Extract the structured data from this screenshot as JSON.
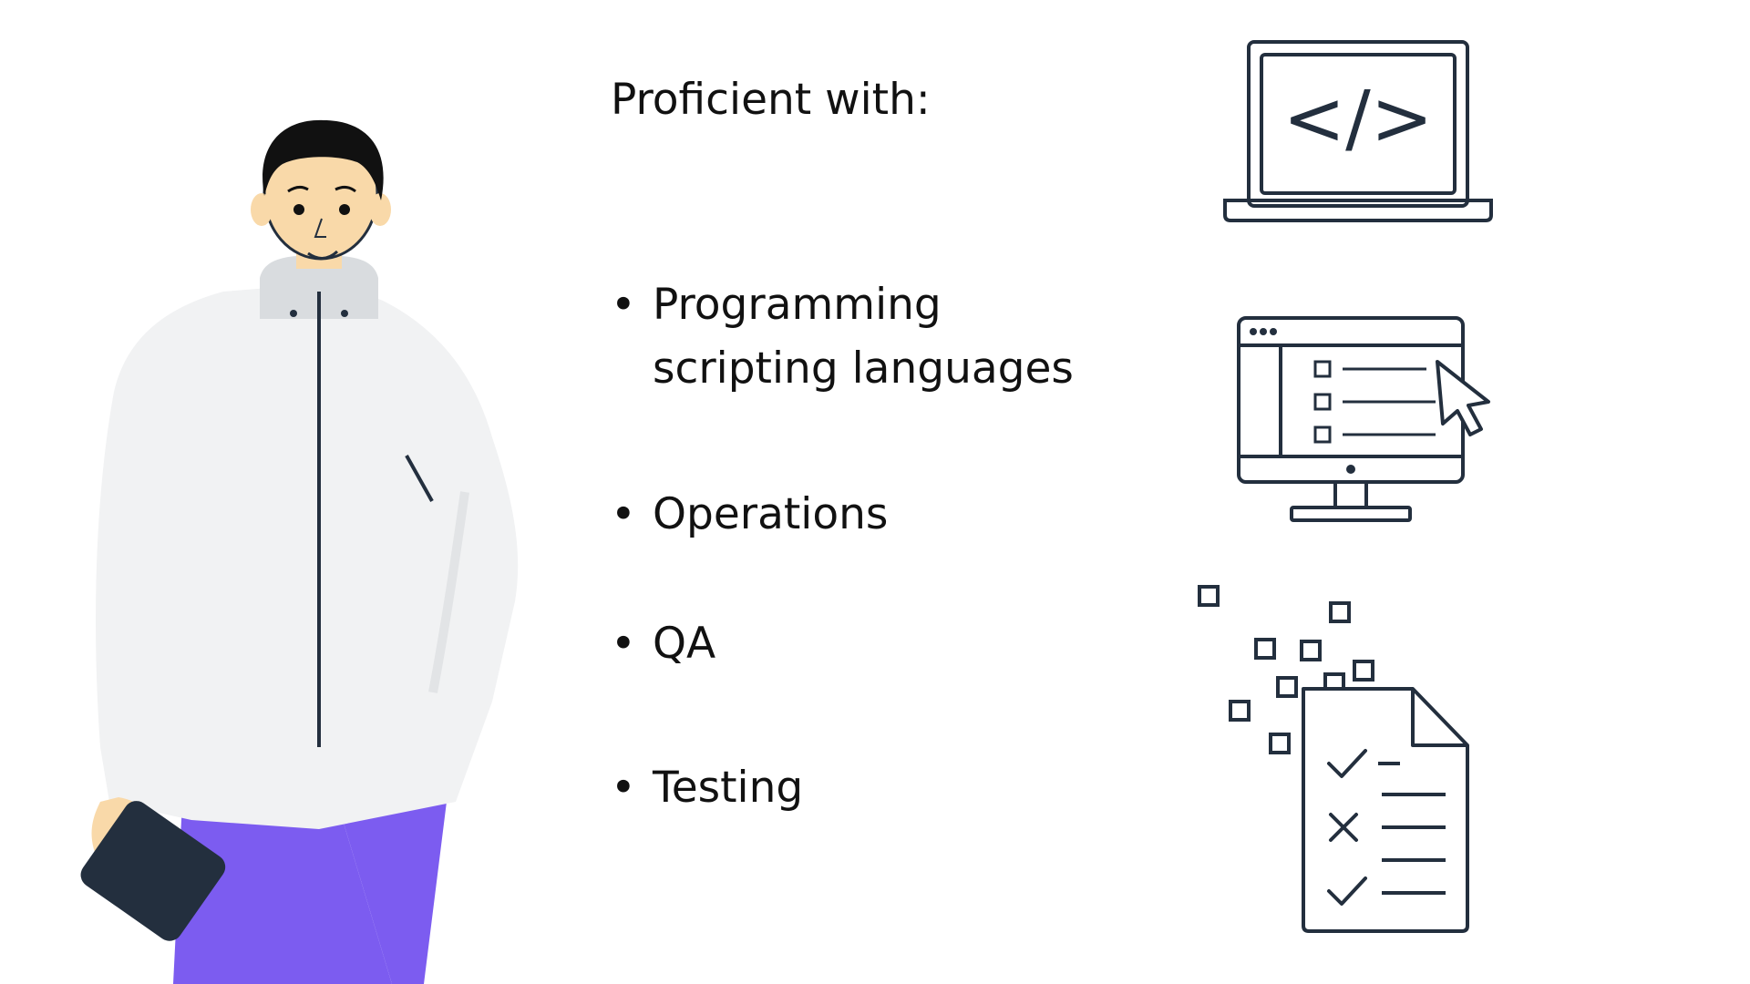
{
  "slide": {
    "heading": "Proficient with:",
    "bullet_symbol": "•",
    "bullets": [
      {
        "line1": "Programming",
        "line2": "scripting languages"
      },
      {
        "line1": "Operations"
      },
      {
        "line1": "QA"
      },
      {
        "line1": "Testing"
      }
    ]
  },
  "icons": {
    "laptop": "laptop-code-icon",
    "monitor": "monitor-checklist-icon",
    "checklist": "document-checklist-icon",
    "laptop_glyph": "</>"
  },
  "colors": {
    "background": "#ffffff",
    "text": "#111111",
    "line_art": "#232f3e",
    "jacket": "#f1f2f3",
    "pants": "#7c5cf0",
    "skin": "#f9d9a9",
    "hair": "#111111",
    "tablet": "#232f3e"
  }
}
